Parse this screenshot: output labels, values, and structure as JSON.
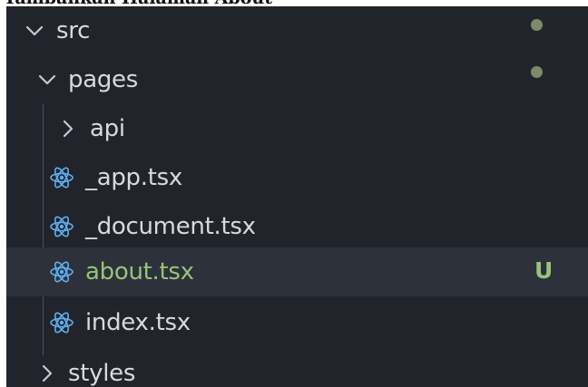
{
  "header_text": "Tambahkan Halaman About",
  "explorer": {
    "src": {
      "label": "src",
      "expanded": true,
      "icon": "chevron-down-icon",
      "status": "modified-dot"
    },
    "pages": {
      "label": "pages",
      "expanded": true,
      "icon": "chevron-down-icon",
      "status": "modified-dot"
    },
    "api": {
      "label": "api",
      "expanded": false,
      "icon": "chevron-right-icon"
    },
    "app_file": {
      "label": "_app.tsx",
      "icon": "react-icon"
    },
    "document_file": {
      "label": "_document.tsx",
      "icon": "react-icon"
    },
    "about_file": {
      "label": "about.tsx",
      "icon": "react-icon",
      "status": "U",
      "selected": true
    },
    "index_file": {
      "label": "index.tsx",
      "icon": "react-icon"
    },
    "styles": {
      "label": "styles",
      "expanded": false,
      "icon": "chevron-right-icon"
    }
  },
  "colors": {
    "background": "#21252b",
    "selected_row": "#2c313a",
    "text": "#d7dae0",
    "untracked_green": "#98c379",
    "modified_dot": "#7a8a6a",
    "react_icon": "#61afef"
  }
}
